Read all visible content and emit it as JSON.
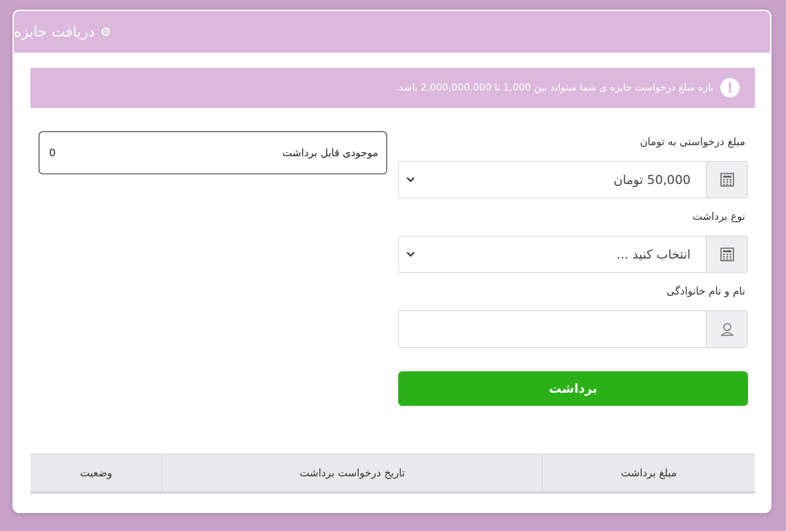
{
  "header": {
    "title": "دریافت جایزه"
  },
  "alert": {
    "message": "بازه مبلغ درخواست جایزه ی شما میتواند بین 1,000 تا 2,000,000,000 باشد."
  },
  "form": {
    "amount_label": "مبلغ درخواستی به تومان",
    "amount_value": "50,000 تومان",
    "type_label": "نوع برداشت",
    "type_value": "انتخاب کنید ...",
    "name_label": "نام و نام خانوادگی",
    "name_value": "",
    "submit_label": "برداشت"
  },
  "balance": {
    "label": "موجودی قابل برداشت",
    "value": "0"
  },
  "table": {
    "columns": [
      "وضعیت",
      "تاریخ درخواست برداشت",
      "مبلغ برداشت"
    ]
  },
  "colors": {
    "header_bg": "#dcb8dd",
    "page_bg": "#c9a2c8",
    "submit_bg": "#2bb118"
  },
  "icons": {
    "header": "circle-bullet-icon",
    "alert": "exclamation-icon",
    "amount_addon": "calculator-icon",
    "type_addon": "calculator-icon",
    "name_addon": "user-icon",
    "select_arrow": "chevron-down-icon"
  }
}
